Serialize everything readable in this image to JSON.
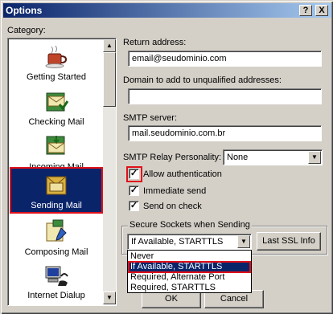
{
  "window": {
    "title": "Options",
    "help_btn": "?",
    "close_btn": "X"
  },
  "category_label": "Category:",
  "categories": [
    {
      "label": "Getting Started",
      "icon": "coffee-cup-icon"
    },
    {
      "label": "Checking Mail",
      "icon": "checking-mail-icon"
    },
    {
      "label": "Incoming Mail",
      "icon": "incoming-mail-icon"
    },
    {
      "label": "Sending Mail",
      "icon": "sending-mail-icon",
      "selected": true
    },
    {
      "label": "Composing Mail",
      "icon": "composing-mail-icon"
    },
    {
      "label": "Internet Dialup",
      "icon": "internet-dialup-icon"
    }
  ],
  "fields": {
    "return_address_label": "Return address:",
    "return_address_value": "email@seudominio.com",
    "domain_label": "Domain to add to unqualified addresses:",
    "domain_value": "",
    "smtp_label": "SMTP server:",
    "smtp_value": "mail.seudominio.com.br",
    "relay_label": "SMTP Relay Personality:",
    "relay_value": "None"
  },
  "checkboxes": {
    "allow_auth": {
      "label": "Allow authentication",
      "checked": true
    },
    "immediate_send": {
      "label": "Immediate send",
      "checked": true
    },
    "send_on_check": {
      "label": "Send on check",
      "checked": true
    }
  },
  "ssl": {
    "group_label": "Secure Sockets when Sending",
    "selected_value": "If Available, STARTTLS",
    "last_ssl_button": "Last SSL Info",
    "options": [
      "Never",
      "If Available, STARTTLS",
      "Required, Alternate Port",
      "Required, STARTTLS"
    ],
    "highlighted_index": 1
  },
  "buttons": {
    "ok": "OK",
    "cancel": "Cancel"
  },
  "colors": {
    "selection": "#0a246a",
    "highlight_box": "#e0101a",
    "face": "#d4d0c8"
  }
}
